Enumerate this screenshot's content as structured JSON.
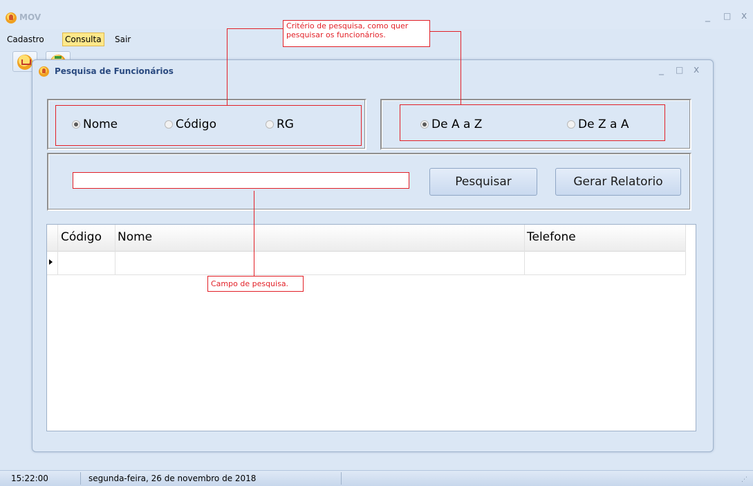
{
  "app": {
    "title": "MOV"
  },
  "menu": {
    "items": [
      "Cadastro",
      "Consulta",
      "Sair"
    ]
  },
  "toolbar": {
    "buttons": [
      "cart-icon",
      "report-icon"
    ]
  },
  "window": {
    "title": "Pesquisa de Funcionários",
    "controls": {
      "minimize": "_",
      "maximize": "□",
      "close": "x"
    }
  },
  "criteria": {
    "options": [
      "Nome",
      "Código",
      "RG"
    ],
    "selected": "Nome"
  },
  "order": {
    "options": [
      "De A a Z",
      "De Z a A"
    ],
    "selected": "De A a Z"
  },
  "search": {
    "value": "",
    "button_label": "Pesquisar",
    "report_label": "Gerar Relatorio"
  },
  "grid": {
    "columns": [
      "Código",
      "Nome",
      "Telefone"
    ],
    "rows": [
      [
        "",
        "",
        ""
      ]
    ]
  },
  "annotations": {
    "criteria_note": "Critério de pesquisa, como quer pesquisar os funcionários.",
    "search_note": "Campo de pesquisa."
  },
  "status": {
    "time": "15:22:00",
    "date": "segunda-feira, 26 de novembro de 2018"
  },
  "colors": {
    "annotation": "#e21f26",
    "background": "#dbe7f5",
    "menu_highlight": "#fde88a"
  }
}
